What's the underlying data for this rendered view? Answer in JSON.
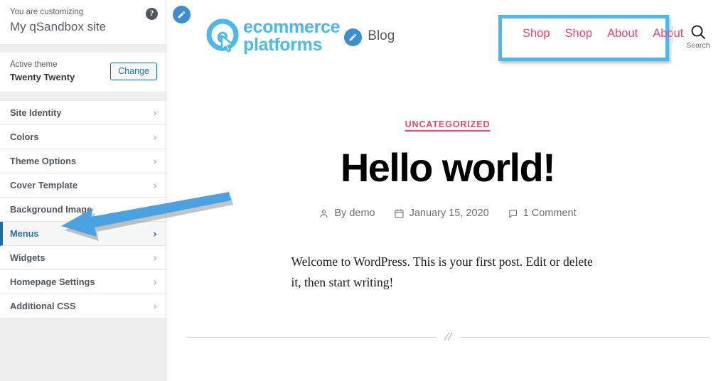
{
  "customizer": {
    "header": {
      "customizing_label": "You are customizing",
      "site_name": "My qSandbox site",
      "help_icon": "help-circle-icon"
    },
    "theme": {
      "active_label": "Active theme",
      "theme_name": "Twenty Twenty",
      "change_button": "Change"
    },
    "panels": [
      {
        "label": "Site Identity",
        "active": false
      },
      {
        "label": "Colors",
        "active": false
      },
      {
        "label": "Theme Options",
        "active": false
      },
      {
        "label": "Cover Template",
        "active": false
      },
      {
        "label": "Background Image",
        "active": false
      },
      {
        "label": "Menus",
        "active": true
      },
      {
        "label": "Widgets",
        "active": false
      },
      {
        "label": "Homepage Settings",
        "active": false
      },
      {
        "label": "Additional CSS",
        "active": false
      }
    ],
    "chevron_glyph": "›"
  },
  "preview": {
    "edit_pencil_icon": "pencil-edit-icon",
    "brand": {
      "logo_icon": "ecommerce-platforms-e-cursor-logo",
      "logo_line1": "ecommerce",
      "logo_line2": "platforms",
      "blog_label": "Blog",
      "logo_color": "#4db8ec"
    },
    "nav": {
      "highlight_color": "#4db8ec",
      "link_color": "#e8476b",
      "items": [
        "Shop",
        "Shop",
        "About",
        "About"
      ]
    },
    "search": {
      "icon": "search-magnifier-icon",
      "label": "Search"
    },
    "post": {
      "category": "UNCATEGORIZED",
      "category_color": "#e8476b",
      "title": "Hello world!",
      "author_icon": "person-icon",
      "author": "By demo",
      "date_icon": "calendar-icon",
      "date": "January 15, 2020",
      "comments_icon": "comment-bubble-icon",
      "comments": "1 Comment",
      "body": "Welcome to WordPress. This is your first post. Edit or delete it, then start writing!",
      "separator_glyph": "//"
    }
  },
  "annotation": {
    "arrow_color": "#4aa3e0",
    "arrow_target": "Menus"
  }
}
